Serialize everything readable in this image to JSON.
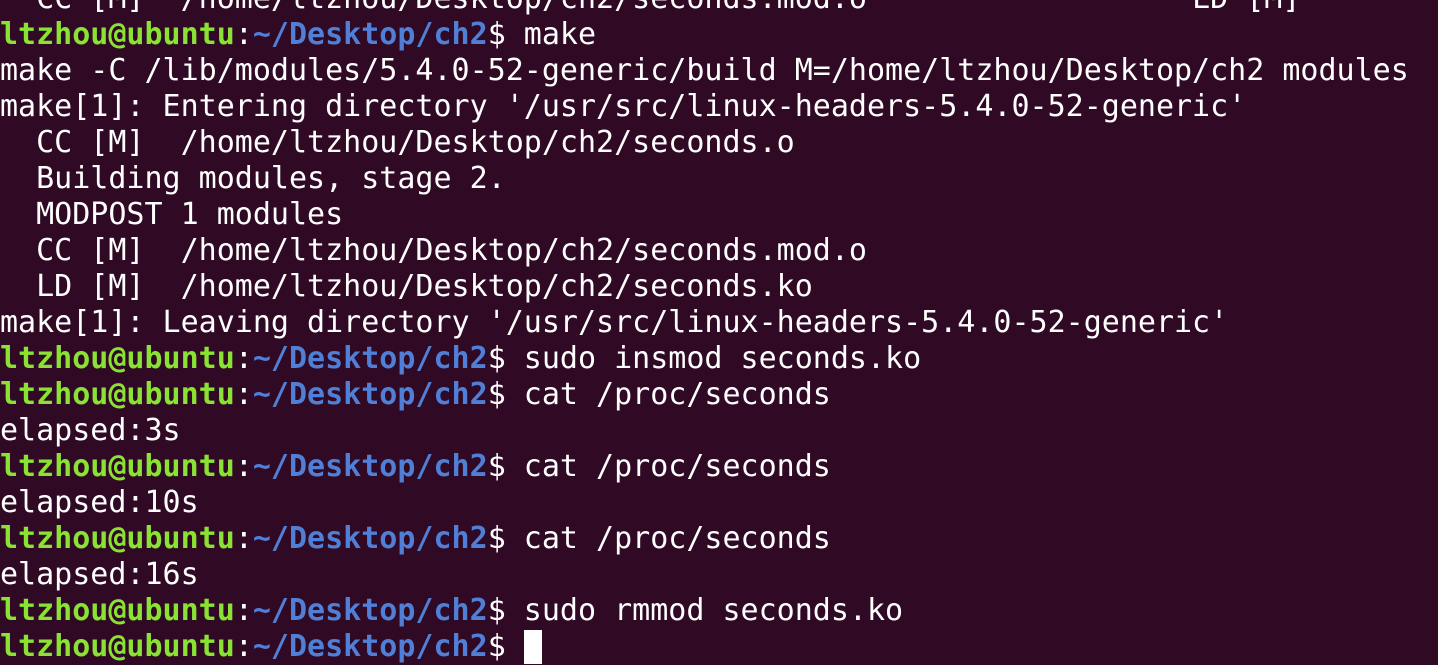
{
  "prompt": {
    "user": "ltzhou@ubuntu",
    "separator": ":",
    "path": "~/Desktop/ch2",
    "symbol": "$"
  },
  "lines": [
    {
      "type": "output",
      "text": "  CC [M]  /home/ltzhou/Desktop/ch2/seconds.mod.o                  LD [M]"
    },
    {
      "type": "command",
      "text": " make"
    },
    {
      "type": "output",
      "text": "make -C /lib/modules/5.4.0-52-generic/build M=/home/ltzhou/Desktop/ch2 modules"
    },
    {
      "type": "output",
      "text": "make[1]: Entering directory '/usr/src/linux-headers-5.4.0-52-generic'"
    },
    {
      "type": "output",
      "text": "  CC [M]  /home/ltzhou/Desktop/ch2/seconds.o"
    },
    {
      "type": "output",
      "text": "  Building modules, stage 2."
    },
    {
      "type": "output",
      "text": "  MODPOST 1 modules"
    },
    {
      "type": "output",
      "text": "  CC [M]  /home/ltzhou/Desktop/ch2/seconds.mod.o"
    },
    {
      "type": "output",
      "text": "  LD [M]  /home/ltzhou/Desktop/ch2/seconds.ko"
    },
    {
      "type": "output",
      "text": "make[1]: Leaving directory '/usr/src/linux-headers-5.4.0-52-generic'"
    },
    {
      "type": "command",
      "text": " sudo insmod seconds.ko"
    },
    {
      "type": "command",
      "text": " cat /proc/seconds"
    },
    {
      "type": "output",
      "text": "elapsed:3s"
    },
    {
      "type": "command",
      "text": " cat /proc/seconds"
    },
    {
      "type": "output",
      "text": "elapsed:10s"
    },
    {
      "type": "command",
      "text": " cat /proc/seconds"
    },
    {
      "type": "output",
      "text": "elapsed:16s"
    },
    {
      "type": "command",
      "text": " sudo rmmod seconds.ko"
    },
    {
      "type": "command",
      "text": " "
    }
  ]
}
